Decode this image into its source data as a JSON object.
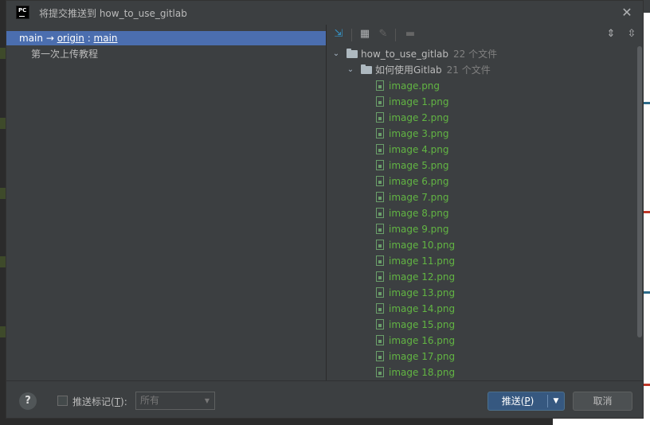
{
  "dialog": {
    "title": "将提交推送到 how_to_use_gitlab",
    "app_logo": "PC"
  },
  "branch_row": {
    "local": "main",
    "arrow": "→",
    "remote": "origin",
    "separator": " : ",
    "remote_branch": "main"
  },
  "commits": [
    {
      "message": "第一次上传教程"
    }
  ],
  "tree": {
    "root": {
      "name": "how_to_use_gitlab",
      "count": "22 个文件"
    },
    "folder": {
      "name": "如何使用Gitlab",
      "count": "21 个文件"
    },
    "files": [
      "image.png",
      "image 1.png",
      "image 2.png",
      "image 3.png",
      "image 4.png",
      "image 5.png",
      "image 6.png",
      "image 7.png",
      "image 8.png",
      "image 9.png",
      "image 10.png",
      "image 11.png",
      "image 12.png",
      "image 13.png",
      "image 14.png",
      "image 15.png",
      "image 16.png",
      "image 17.png",
      "image 18.png"
    ]
  },
  "footer": {
    "help": "?",
    "push_tags_label": "推送标记(",
    "push_tags_mnemonic": "T",
    "push_tags_suffix": "):",
    "tags_select_value": "所有",
    "push_label": "推送(",
    "push_mnemonic": "P",
    "push_suffix": ")",
    "cancel_label": "取消"
  },
  "icons": {
    "toolbar": [
      "expand-collapse-icon",
      "group-by-icon",
      "edit-icon",
      "save-icon",
      "expand-all-icon",
      "collapse-all-icon"
    ]
  },
  "colors": {
    "selection": "#4b6eaf",
    "added_file": "#62b543",
    "push_button": "#365880"
  }
}
